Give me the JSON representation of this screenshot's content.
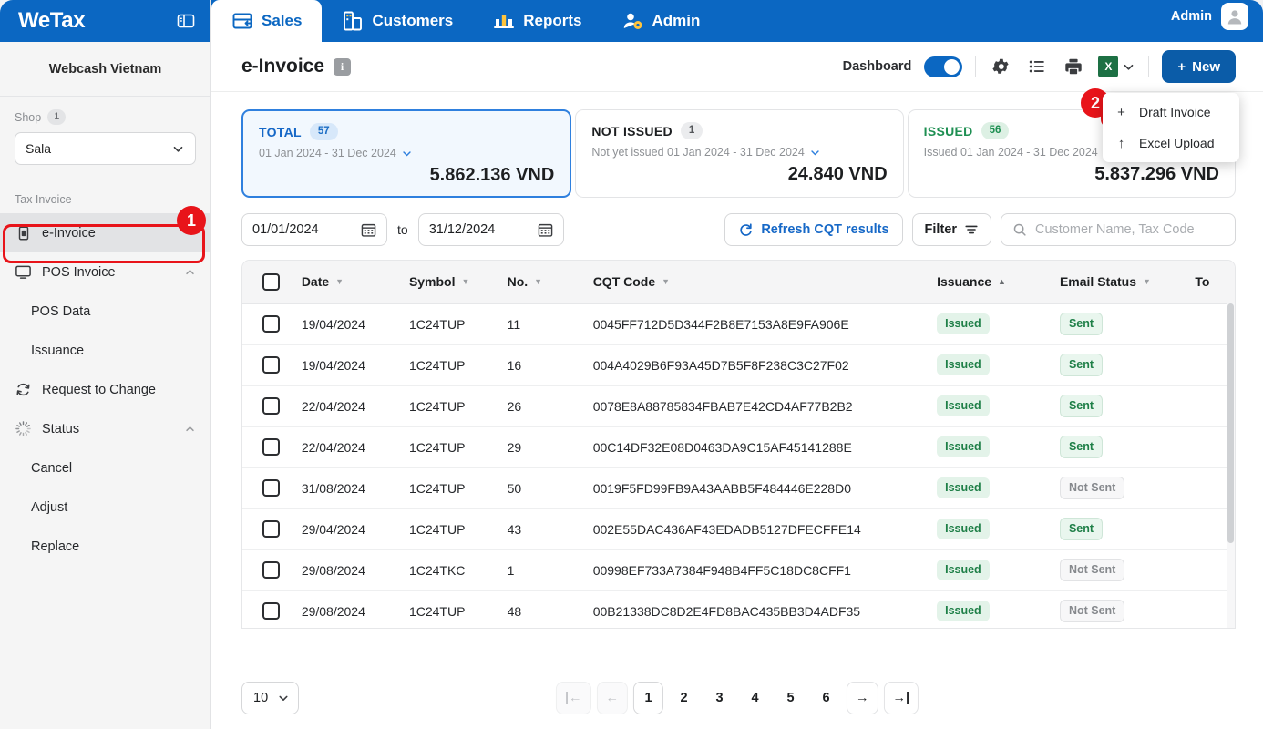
{
  "brand": {
    "logo": "WeTax",
    "panel_icon": "panel-toggle-icon",
    "org": "Webcash Vietnam"
  },
  "sidebar": {
    "shop_label": "Shop",
    "shop_count": "1",
    "shop_selected": "Sala",
    "section_label": "Tax Invoice",
    "items": [
      {
        "label": "e-Invoice",
        "icon": "e-invoice-icon",
        "active": true,
        "sub": false,
        "chev": ""
      },
      {
        "label": "POS Invoice",
        "icon": "monitor-icon",
        "active": false,
        "sub": false,
        "chev": "up"
      },
      {
        "label": "POS Data",
        "icon": "",
        "active": false,
        "sub": true,
        "chev": ""
      },
      {
        "label": "Issuance",
        "icon": "",
        "active": false,
        "sub": true,
        "chev": ""
      },
      {
        "label": "Request to Change",
        "icon": "refresh-circle-icon",
        "active": false,
        "sub": false,
        "chev": ""
      },
      {
        "label": "Status",
        "icon": "spinner-icon",
        "active": false,
        "sub": false,
        "chev": "up"
      },
      {
        "label": "Cancel",
        "icon": "",
        "active": false,
        "sub": true,
        "chev": ""
      },
      {
        "label": "Adjust",
        "icon": "",
        "active": false,
        "sub": true,
        "chev": ""
      },
      {
        "label": "Replace",
        "icon": "",
        "active": false,
        "sub": true,
        "chev": ""
      }
    ]
  },
  "topnav": {
    "tabs": [
      {
        "label": "Sales",
        "icon": "sales-icon",
        "active": true
      },
      {
        "label": "Customers",
        "icon": "customers-icon",
        "active": false
      },
      {
        "label": "Reports",
        "icon": "reports-icon",
        "active": false
      },
      {
        "label": "Admin",
        "icon": "admin-icon",
        "active": false
      }
    ],
    "user_label": "Admin",
    "avatar_icon": "user-avatar-icon"
  },
  "page": {
    "title": "e-Invoice",
    "info_icon": "info-icon",
    "dashboard_label": "Dashboard",
    "dashboard_on": true,
    "gear_icon": "gear-icon",
    "list_icon": "list-icon",
    "print_icon": "print-icon",
    "excel_icon": "excel-icon",
    "excel_caret": "chevron-down-icon",
    "new_label": "New"
  },
  "dropdown": {
    "items": [
      {
        "label": "Draft Invoice",
        "icon": "plus-icon",
        "highlighted": true
      },
      {
        "label": "Excel Upload",
        "icon": "upload-arrow-icon",
        "highlighted": false
      }
    ]
  },
  "callouts": [
    {
      "number": "1",
      "target": "sidebar-item-e-invoice"
    },
    {
      "number": "2",
      "target": "dropdown-item-draft-invoice"
    }
  ],
  "cards": [
    {
      "title": "TOTAL",
      "count": "57",
      "selected": true,
      "subtitle": "01 Jan 2024 - 31 Dec 2024",
      "amount": "5.862.136 VND",
      "title_class": "total",
      "pill_class": "blue"
    },
    {
      "title": "NOT ISSUED",
      "count": "1",
      "selected": false,
      "subtitle": "Not yet issued 01 Jan 2024 - 31 Dec 2024",
      "amount": "24.840 VND",
      "title_class": "notissued",
      "pill_class": "gray"
    },
    {
      "title": "ISSUED",
      "count": "56",
      "selected": false,
      "subtitle": "Issued 01 Jan 2024 - 31 Dec 2024",
      "amount": "5.837.296 VND",
      "title_class": "issued",
      "pill_class": "green"
    }
  ],
  "filters": {
    "date_from": "01/01/2024",
    "date_to": "31/12/2024",
    "to_label": "to",
    "calendar_icon": "calendar-icon",
    "refresh_label": "Refresh CQT results",
    "refresh_icon": "refresh-icon",
    "filter_label": "Filter",
    "filter_icon": "filter-icon",
    "search_icon": "search-icon",
    "search_value": "",
    "search_placeholder": "Customer Name, Tax Code"
  },
  "table": {
    "columns": [
      {
        "label": "",
        "sort": "",
        "key": "check"
      },
      {
        "label": "Date",
        "sort": "desc",
        "key": "date"
      },
      {
        "label": "Symbol",
        "sort": "desc",
        "key": "symbol"
      },
      {
        "label": "No.",
        "sort": "desc",
        "key": "no"
      },
      {
        "label": "CQT Code",
        "sort": "desc",
        "key": "cqt"
      },
      {
        "label": "Issuance",
        "sort": "asc",
        "key": "issuance"
      },
      {
        "label": "Email Status",
        "sort": "desc",
        "key": "email"
      },
      {
        "label": "To",
        "sort": "",
        "key": "total"
      }
    ],
    "rows": [
      {
        "date": "19/04/2024",
        "symbol": "1C24TUP",
        "no": "11",
        "cqt": "0045FF712D5D344F2B8E7153A8E9FA906E",
        "issuance": "Issued",
        "email": "Sent",
        "total": ""
      },
      {
        "date": "19/04/2024",
        "symbol": "1C24TUP",
        "no": "16",
        "cqt": "004A4029B6F93A45D7B5F8F238C3C27F02",
        "issuance": "Issued",
        "email": "Sent",
        "total": ""
      },
      {
        "date": "22/04/2024",
        "symbol": "1C24TUP",
        "no": "26",
        "cqt": "0078E8A88785834FBAB7E42CD4AF77B2B2",
        "issuance": "Issued",
        "email": "Sent",
        "total": ""
      },
      {
        "date": "22/04/2024",
        "symbol": "1C24TUP",
        "no": "29",
        "cqt": "00C14DF32E08D0463DA9C15AF45141288E",
        "issuance": "Issued",
        "email": "Sent",
        "total": ""
      },
      {
        "date": "31/08/2024",
        "symbol": "1C24TUP",
        "no": "50",
        "cqt": "0019F5FD99FB9A43AABB5F484446E228D0",
        "issuance": "Issued",
        "email": "Not Sent",
        "total": ""
      },
      {
        "date": "29/04/2024",
        "symbol": "1C24TUP",
        "no": "43",
        "cqt": "002E55DAC436AF43EDADB5127DFECFFE14",
        "issuance": "Issued",
        "email": "Sent",
        "total": ""
      },
      {
        "date": "29/08/2024",
        "symbol": "1C24TKC",
        "no": "1",
        "cqt": "00998EF733A7384F948B4FF5C18DC8CFF1",
        "issuance": "Issued",
        "email": "Not Sent",
        "total": ""
      },
      {
        "date": "29/08/2024",
        "symbol": "1C24TUP",
        "no": "48",
        "cqt": "00B21338DC8D2E4FD8BAC435BB3D4ADF35",
        "issuance": "Issued",
        "email": "Not Sent",
        "total": ""
      }
    ]
  },
  "footer": {
    "page_size": "10",
    "pages": [
      "1",
      "2",
      "3",
      "4",
      "5",
      "6"
    ],
    "current_page": "1",
    "first_icon": "first-page-icon",
    "prev_icon": "prev-page-icon",
    "next_icon": "next-page-icon",
    "last_icon": "last-page-icon"
  },
  "colors": {
    "brand_blue": "#0B67C2",
    "accent_blue": "#1668C7",
    "callout_red": "#E8141A",
    "green": "#1E8F52",
    "excel_green": "#1D7044"
  }
}
